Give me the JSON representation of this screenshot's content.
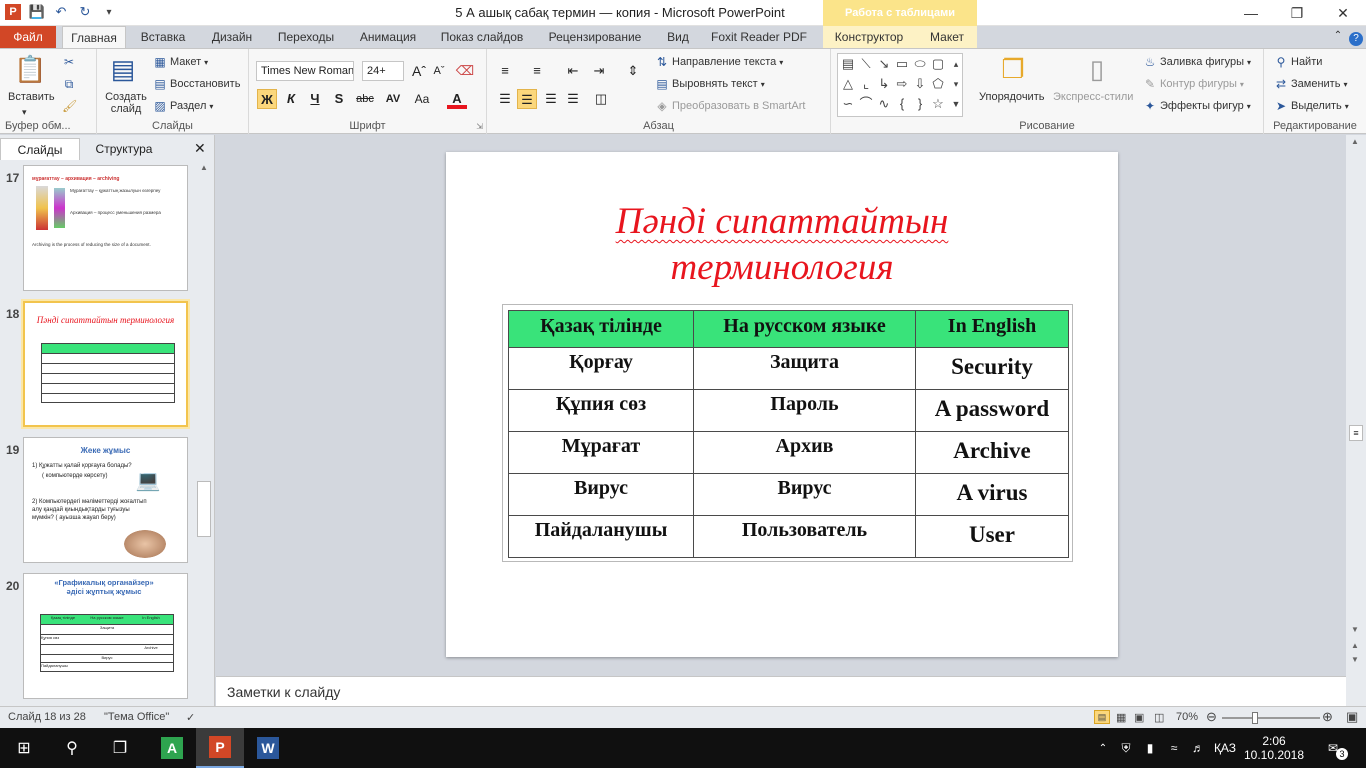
{
  "window": {
    "title": "5 А ашық сабақ термин — копия  -  Microsoft PowerPoint",
    "context_title": "Работа с таблицами"
  },
  "tabs": {
    "file": "Файл",
    "items": [
      "Главная",
      "Вставка",
      "Дизайн",
      "Переходы",
      "Анимация",
      "Показ слайдов",
      "Рецензирование",
      "Вид",
      "Foxit Reader PDF",
      "Конструктор",
      "Макет"
    ]
  },
  "ribbon": {
    "clipboard": {
      "paste": "Вставить",
      "label": "Буфер обм..."
    },
    "slides": {
      "new_slide": "Создать слайд",
      "layout": "Макет",
      "reset": "Восстановить",
      "section": "Раздел",
      "label": "Слайды"
    },
    "font": {
      "name": "Times New Roman",
      "size": "24+",
      "bold": "Ж",
      "italic": "К",
      "underline": "Ч",
      "shadow": "S",
      "strike": "abc",
      "spacing": "AV",
      "case": "Aa",
      "color": "A",
      "label": "Шрифт"
    },
    "paragraph": {
      "text_direction": "Направление текста",
      "align_text": "Выровнять текст",
      "smartart": "Преобразовать в SmartArt",
      "label": "Абзац"
    },
    "drawing": {
      "arrange": "Упорядочить",
      "quick_styles": "Экспресс-стили",
      "fill": "Заливка фигуры",
      "outline": "Контур фигуры",
      "effects": "Эффекты фигур",
      "label": "Рисование"
    },
    "editing": {
      "find": "Найти",
      "replace": "Заменить",
      "select": "Выделить",
      "label": "Редактирование"
    }
  },
  "pane": {
    "tab_slides": "Слайды",
    "tab_outline": "Структура",
    "thumbs": [
      {
        "num": "17",
        "heading": "мұрағаттау – архивация – archiving",
        "lines": [
          "Мұрағаттау – құжаттың жазылуын өзгерпеу",
          "Архивация – процесс уменьшения размера",
          "Archiving is the process of reducing the size of a document."
        ]
      },
      {
        "num": "18",
        "title": "Пәнді сипаттайтын терминология"
      },
      {
        "num": "19",
        "heading": "Жеке жұмыс",
        "lines": [
          "1) Құжатты қалай қорғауға болады?",
          "( компьютерде көрсету)",
          "2) Компьютердегі мәліметтерді жоғалтып алу қандай қиындықтарды туғызуы мүмкін? ( ауызша жауап беру)"
        ]
      },
      {
        "num": "20",
        "heading": "«Графикалық органайзер» әдісі жұптық жұмыс",
        "cells": [
          "Қазақ тілінде",
          "На русском языке",
          "In English",
          "Защита",
          "Құпия сөз",
          "Archive",
          "Вирус",
          "Пайдаланушы"
        ]
      }
    ]
  },
  "slide": {
    "title_line1": "Пәнді сипаттайтын",
    "title_line2": "терминология",
    "headers": [
      "Қазақ тілінде",
      "На русском языке",
      "In English"
    ],
    "rows": [
      [
        "Қорғау",
        "Защита",
        "Security"
      ],
      [
        "Құпия сөз",
        "Пароль",
        "A password"
      ],
      [
        "Мұрағат",
        "Архив",
        "Archive"
      ],
      [
        "Вирус",
        "Вирус",
        "A virus"
      ],
      [
        "Пайдаланушы",
        "Пользователь",
        "User"
      ]
    ],
    "header_color": "#39e37a",
    "title_color": "#e8151e"
  },
  "notes": {
    "placeholder": "Заметки к слайду"
  },
  "status": {
    "slide": "Слайд 18 из 28",
    "theme": "\"Тема Office\"",
    "zoom": "70%",
    "zoom_level": 0.7
  },
  "taskbar": {
    "lang": "ҚАЗ",
    "time": "2:06",
    "date": "10.10.2018",
    "notifications": "3"
  }
}
